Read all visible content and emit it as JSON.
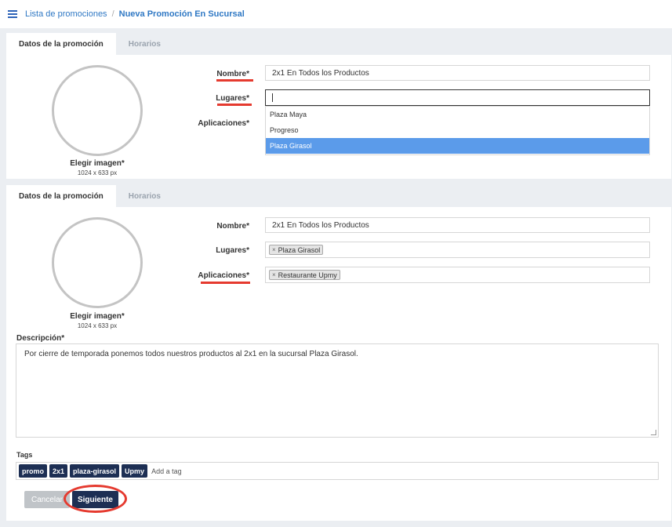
{
  "breadcrumb": {
    "parent": "Lista de promociones",
    "separator": "/",
    "current": "Nueva Promoción En Sucursal"
  },
  "tabs": {
    "data_tab": "Datos de la promoción",
    "schedule_tab": "Horarios"
  },
  "image": {
    "label": "Elegir imagen*",
    "size": "1024 x 633 px"
  },
  "form": {
    "nombre_label": "Nombre*",
    "nombre_value": "2x1 En Todos los Productos",
    "lugares_label": "Lugares*",
    "aplicaciones_label": "Aplicaciones*",
    "descripcion_label": "Descripción*",
    "tags_label": "Tags"
  },
  "dropdown_options": [
    "Plaza Maya",
    "Progreso",
    "Plaza Girasol"
  ],
  "selected": {
    "lugar": "Plaza Girasol",
    "aplicacion": "Restaurante Upmy",
    "remove_symbol": "×"
  },
  "description_text": "Por cierre de temporada ponemos todos nuestros productos al 2x1 en la sucursal Plaza Girasol.",
  "tags": [
    "promo",
    "2x1",
    "plaza-girasol",
    "Upmy"
  ],
  "tag_placeholder": "Add a tag",
  "buttons": {
    "cancel": "Cancelar",
    "next": "Siguiente"
  },
  "colors": {
    "accent_link": "#2f78c4",
    "highlight_red": "#e53a2f",
    "primary_dark": "#1d2f54",
    "dropdown_selected": "#5b9bea"
  }
}
